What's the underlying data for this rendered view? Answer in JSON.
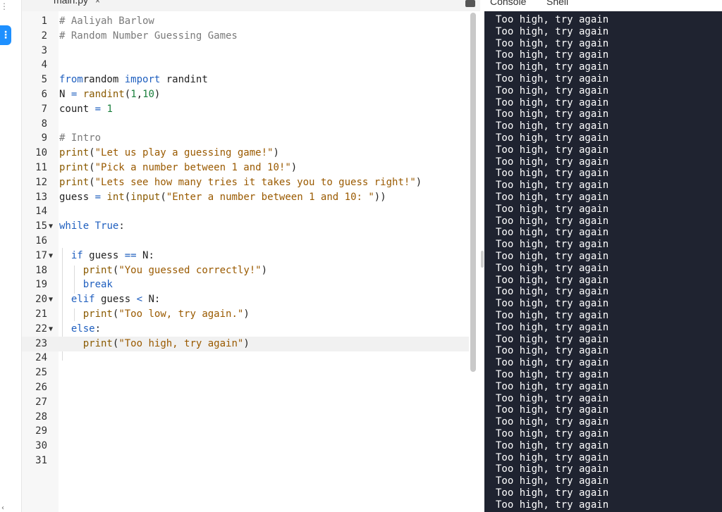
{
  "file_tab": {
    "name": "main.py",
    "close": "×"
  },
  "console_tabs": [
    "Console",
    "Shell"
  ],
  "editor": {
    "lines": [
      {
        "n": "1",
        "fold": "",
        "tokens": [
          [
            "c-com",
            "# Aaliyah Barlow"
          ]
        ]
      },
      {
        "n": "2",
        "fold": "",
        "tokens": [
          [
            "c-com",
            "# Random Number Guessing Games"
          ]
        ]
      },
      {
        "n": "3",
        "fold": "",
        "tokens": []
      },
      {
        "n": "4",
        "fold": "",
        "tokens": []
      },
      {
        "n": "5",
        "fold": "",
        "tokens": [
          [
            "c-kw",
            "from"
          ],
          [
            "",
            "random "
          ],
          [
            "c-kw",
            "import"
          ],
          [
            "",
            " randint"
          ]
        ]
      },
      {
        "n": "6",
        "fold": "",
        "tokens": [
          [
            "",
            "N "
          ],
          [
            "c-kw",
            "="
          ],
          [
            "",
            " "
          ],
          [
            "c-fn",
            "randint"
          ],
          [
            "",
            "("
          ],
          [
            "c-num",
            "1"
          ],
          [
            "",
            ","
          ],
          [
            "c-num",
            "10"
          ],
          [
            "",
            ")"
          ]
        ]
      },
      {
        "n": "7",
        "fold": "",
        "tokens": [
          [
            "",
            "count "
          ],
          [
            "c-kw",
            "="
          ],
          [
            "",
            " "
          ],
          [
            "c-num",
            "1"
          ]
        ]
      },
      {
        "n": "8",
        "fold": "",
        "tokens": []
      },
      {
        "n": "9",
        "fold": "",
        "tokens": [
          [
            "c-com",
            "# Intro"
          ]
        ]
      },
      {
        "n": "10",
        "fold": "",
        "tokens": [
          [
            "c-fn",
            "print"
          ],
          [
            "",
            "("
          ],
          [
            "c-str",
            "\"Let us play a guessing game!\""
          ],
          [
            "",
            ")"
          ]
        ]
      },
      {
        "n": "11",
        "fold": "",
        "tokens": [
          [
            "c-fn",
            "print"
          ],
          [
            "",
            "("
          ],
          [
            "c-str",
            "\"Pick a number between 1 and 10!\""
          ],
          [
            "",
            ")"
          ]
        ]
      },
      {
        "n": "12",
        "fold": "",
        "tokens": [
          [
            "c-fn",
            "print"
          ],
          [
            "",
            "("
          ],
          [
            "c-str",
            "\"Lets see how many tries it takes you to guess right!\""
          ],
          [
            "",
            ")"
          ]
        ]
      },
      {
        "n": "13",
        "fold": "",
        "tokens": [
          [
            "",
            "guess "
          ],
          [
            "c-kw",
            "="
          ],
          [
            "",
            " "
          ],
          [
            "c-fn",
            "int"
          ],
          [
            "",
            "("
          ],
          [
            "c-fn",
            "input"
          ],
          [
            "",
            "("
          ],
          [
            "c-str",
            "\"Enter a number between 1 and 10: \""
          ],
          [
            "",
            "))"
          ]
        ]
      },
      {
        "n": "14",
        "fold": "",
        "tokens": []
      },
      {
        "n": "15",
        "fold": "▼",
        "tokens": [
          [
            "c-kw",
            "while"
          ],
          [
            "",
            " "
          ],
          [
            "c-kw",
            "True"
          ],
          [
            "",
            ":"
          ]
        ]
      },
      {
        "n": "16",
        "fold": "",
        "tokens": []
      },
      {
        "n": "17",
        "fold": "▼",
        "tokens": [
          [
            "",
            "  "
          ],
          [
            "c-kw",
            "if"
          ],
          [
            "",
            " guess "
          ],
          [
            "c-kw",
            "=="
          ],
          [
            "",
            " N:"
          ]
        ]
      },
      {
        "n": "18",
        "fold": "",
        "tokens": [
          [
            "",
            "    "
          ],
          [
            "c-fn",
            "print"
          ],
          [
            "",
            "("
          ],
          [
            "c-str",
            "\"You guessed correctly!\""
          ],
          [
            "",
            ")"
          ]
        ]
      },
      {
        "n": "19",
        "fold": "",
        "tokens": [
          [
            "",
            "    "
          ],
          [
            "c-kw",
            "break"
          ]
        ]
      },
      {
        "n": "20",
        "fold": "▼",
        "tokens": [
          [
            "",
            "  "
          ],
          [
            "c-kw",
            "elif"
          ],
          [
            "",
            " guess "
          ],
          [
            "c-kw",
            "<"
          ],
          [
            "",
            " N:"
          ]
        ]
      },
      {
        "n": "21",
        "fold": "",
        "tokens": [
          [
            "",
            "    "
          ],
          [
            "c-fn",
            "print"
          ],
          [
            "",
            "("
          ],
          [
            "c-str",
            "\"Too low, try again.\""
          ],
          [
            "",
            ")"
          ]
        ]
      },
      {
        "n": "22",
        "fold": "▼",
        "tokens": [
          [
            "",
            "  "
          ],
          [
            "c-kw",
            "else"
          ],
          [
            "",
            ":"
          ]
        ]
      },
      {
        "n": "23",
        "fold": "",
        "tokens": [
          [
            "",
            "    "
          ],
          [
            "c-fn",
            "print"
          ],
          [
            "",
            "("
          ],
          [
            "c-str",
            "\"Too high, try again\""
          ],
          [
            "",
            ")"
          ]
        ]
      },
      {
        "n": "24",
        "fold": "",
        "tokens": []
      },
      {
        "n": "25",
        "fold": "",
        "tokens": []
      },
      {
        "n": "26",
        "fold": "",
        "tokens": []
      },
      {
        "n": "27",
        "fold": "",
        "tokens": []
      },
      {
        "n": "28",
        "fold": "",
        "tokens": []
      },
      {
        "n": "29",
        "fold": "",
        "tokens": []
      },
      {
        "n": "30",
        "fold": "",
        "tokens": []
      },
      {
        "n": "31",
        "fold": "",
        "tokens": []
      }
    ],
    "active_line": "23"
  },
  "console": {
    "output": [
      "Too high, try again",
      "Too high, try again",
      "Too high, try again",
      "Too high, try again",
      "Too high, try again",
      "Too high, try again",
      "Too high, try again",
      "Too high, try again",
      "Too high, try again",
      "Too high, try again",
      "Too high, try again",
      "Too high, try again",
      "Too high, try again",
      "Too high, try again",
      "Too high, try again",
      "Too high, try again",
      "Too high, try again",
      "Too high, try again",
      "Too high, try again",
      "Too high, try again",
      "Too high, try again",
      "Too high, try again",
      "Too high, try again",
      "Too high, try again",
      "Too high, try again",
      "Too high, try again",
      "Too high, try again",
      "Too high, try again",
      "Too high, try again",
      "Too high, try again",
      "Too high, try again",
      "Too high, try again",
      "Too high, try again",
      "Too high, try again",
      "Too high, try again",
      "Too high, try again",
      "Too high, try again",
      "Too high, try again",
      "Too high, try again",
      "Too high, try again",
      "Too high, try again",
      "Too high, try again"
    ]
  },
  "colors": {
    "console_bg": "#1f2330",
    "accent": "#1e90ff"
  }
}
